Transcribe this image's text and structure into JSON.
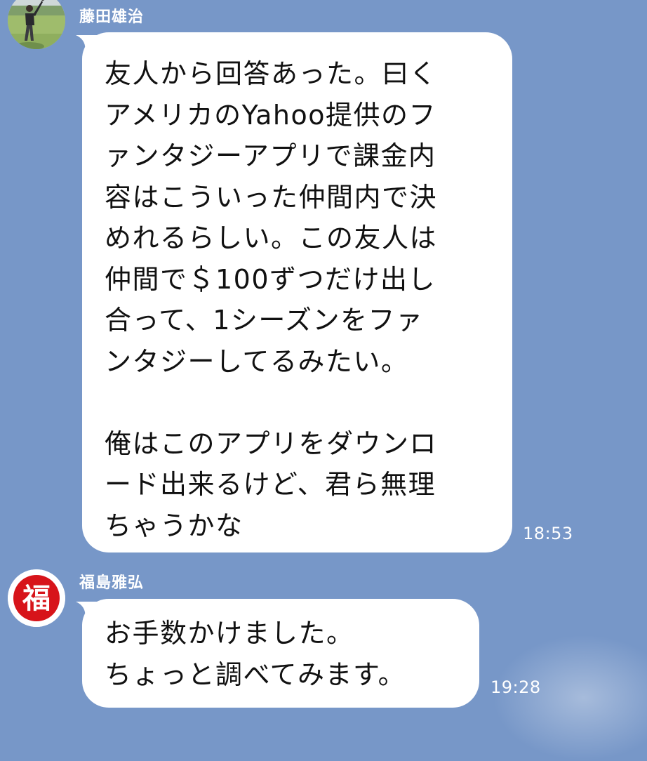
{
  "messages": [
    {
      "sender": "藤田雄治",
      "avatar": "golfer-photo-avatar",
      "lines": [
        "友人から回答あった。曰く",
        "アメリカのYahoo提供のフ",
        "ァンタジーアプリで課金内",
        "容はこういった仲間内で決",
        "めれるらしい。この友人は",
        "仲間で＄100ずつだけ出し",
        "合って、1シーズンをファ",
        "ンタジーしてるみたい。",
        "",
        "俺はこのアプリをダウンロ",
        "ード出来るけど、君ら無理",
        "ちゃうかな"
      ],
      "time": "18:53"
    },
    {
      "sender": "福島雅弘",
      "avatar": "fuku-kanji-avatar",
      "avatar_text": "福",
      "lines": [
        "お手数かけました。",
        "ちょっと調べてみます。"
      ],
      "time": "19:28"
    }
  ],
  "colors": {
    "background": "#7797c8",
    "bubble": "#ffffff",
    "name_text": "#ffffff",
    "fuku_red": "#d7141a"
  }
}
